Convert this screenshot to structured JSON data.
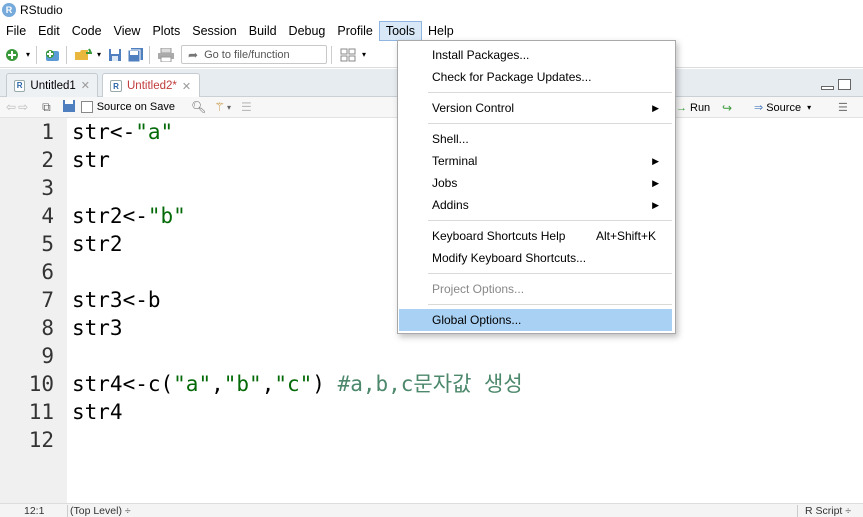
{
  "app": {
    "title": "RStudio",
    "logo_letter": "R"
  },
  "menubar": [
    "File",
    "Edit",
    "Code",
    "View",
    "Plots",
    "Session",
    "Build",
    "Debug",
    "Profile",
    "Tools",
    "Help"
  ],
  "toolbar": {
    "goto_placeholder": "Go to file/function"
  },
  "tabs": [
    {
      "label": "Untitled1",
      "active": false
    },
    {
      "label": "Untitled2*",
      "active": true
    }
  ],
  "editor_toolbar": {
    "source_on_save": "Source on Save",
    "run": "Run",
    "source": "Source"
  },
  "code_lines": [
    {
      "num": "1",
      "parts": [
        [
          "op",
          "str<-"
        ],
        [
          "str",
          "\"a\""
        ]
      ]
    },
    {
      "num": "2",
      "parts": [
        [
          "op",
          "str"
        ]
      ]
    },
    {
      "num": "3",
      "parts": []
    },
    {
      "num": "4",
      "parts": [
        [
          "op",
          "str2<-"
        ],
        [
          "str",
          "\"b\""
        ]
      ]
    },
    {
      "num": "5",
      "parts": [
        [
          "op",
          "str2"
        ]
      ]
    },
    {
      "num": "6",
      "parts": []
    },
    {
      "num": "7",
      "parts": [
        [
          "op",
          "str3<-b"
        ]
      ]
    },
    {
      "num": "8",
      "parts": [
        [
          "op",
          "str3"
        ]
      ]
    },
    {
      "num": "9",
      "parts": []
    },
    {
      "num": "10",
      "parts": [
        [
          "op",
          "str4<-c("
        ],
        [
          "str",
          "\"a\""
        ],
        [
          "op",
          ","
        ],
        [
          "str",
          "\"b\""
        ],
        [
          "op",
          ","
        ],
        [
          "str",
          "\"c\""
        ],
        [
          "op",
          ") "
        ],
        [
          "cmt",
          "#a,b,c문자값 생성"
        ]
      ]
    },
    {
      "num": "11",
      "parts": [
        [
          "op",
          "str4"
        ]
      ]
    },
    {
      "num": "12",
      "parts": []
    }
  ],
  "statusbar": {
    "position": "12:1",
    "scope": "(Top Level) ÷",
    "filetype": "R Script ÷"
  },
  "tools_menu": {
    "install_packages": "Install Packages...",
    "check_updates": "Check for Package Updates...",
    "version_control": "Version Control",
    "shell": "Shell...",
    "terminal": "Terminal",
    "jobs": "Jobs",
    "addins": "Addins",
    "keyboard_help": "Keyboard Shortcuts Help",
    "keyboard_help_shortcut": "Alt+Shift+K",
    "modify_shortcuts": "Modify Keyboard Shortcuts...",
    "project_options": "Project Options...",
    "global_options": "Global Options..."
  },
  "colors": {
    "string": "#036a07",
    "comment": "#4c886b",
    "highlight": "#a9d1f3",
    "active_tab_label": "#c03a3a"
  }
}
